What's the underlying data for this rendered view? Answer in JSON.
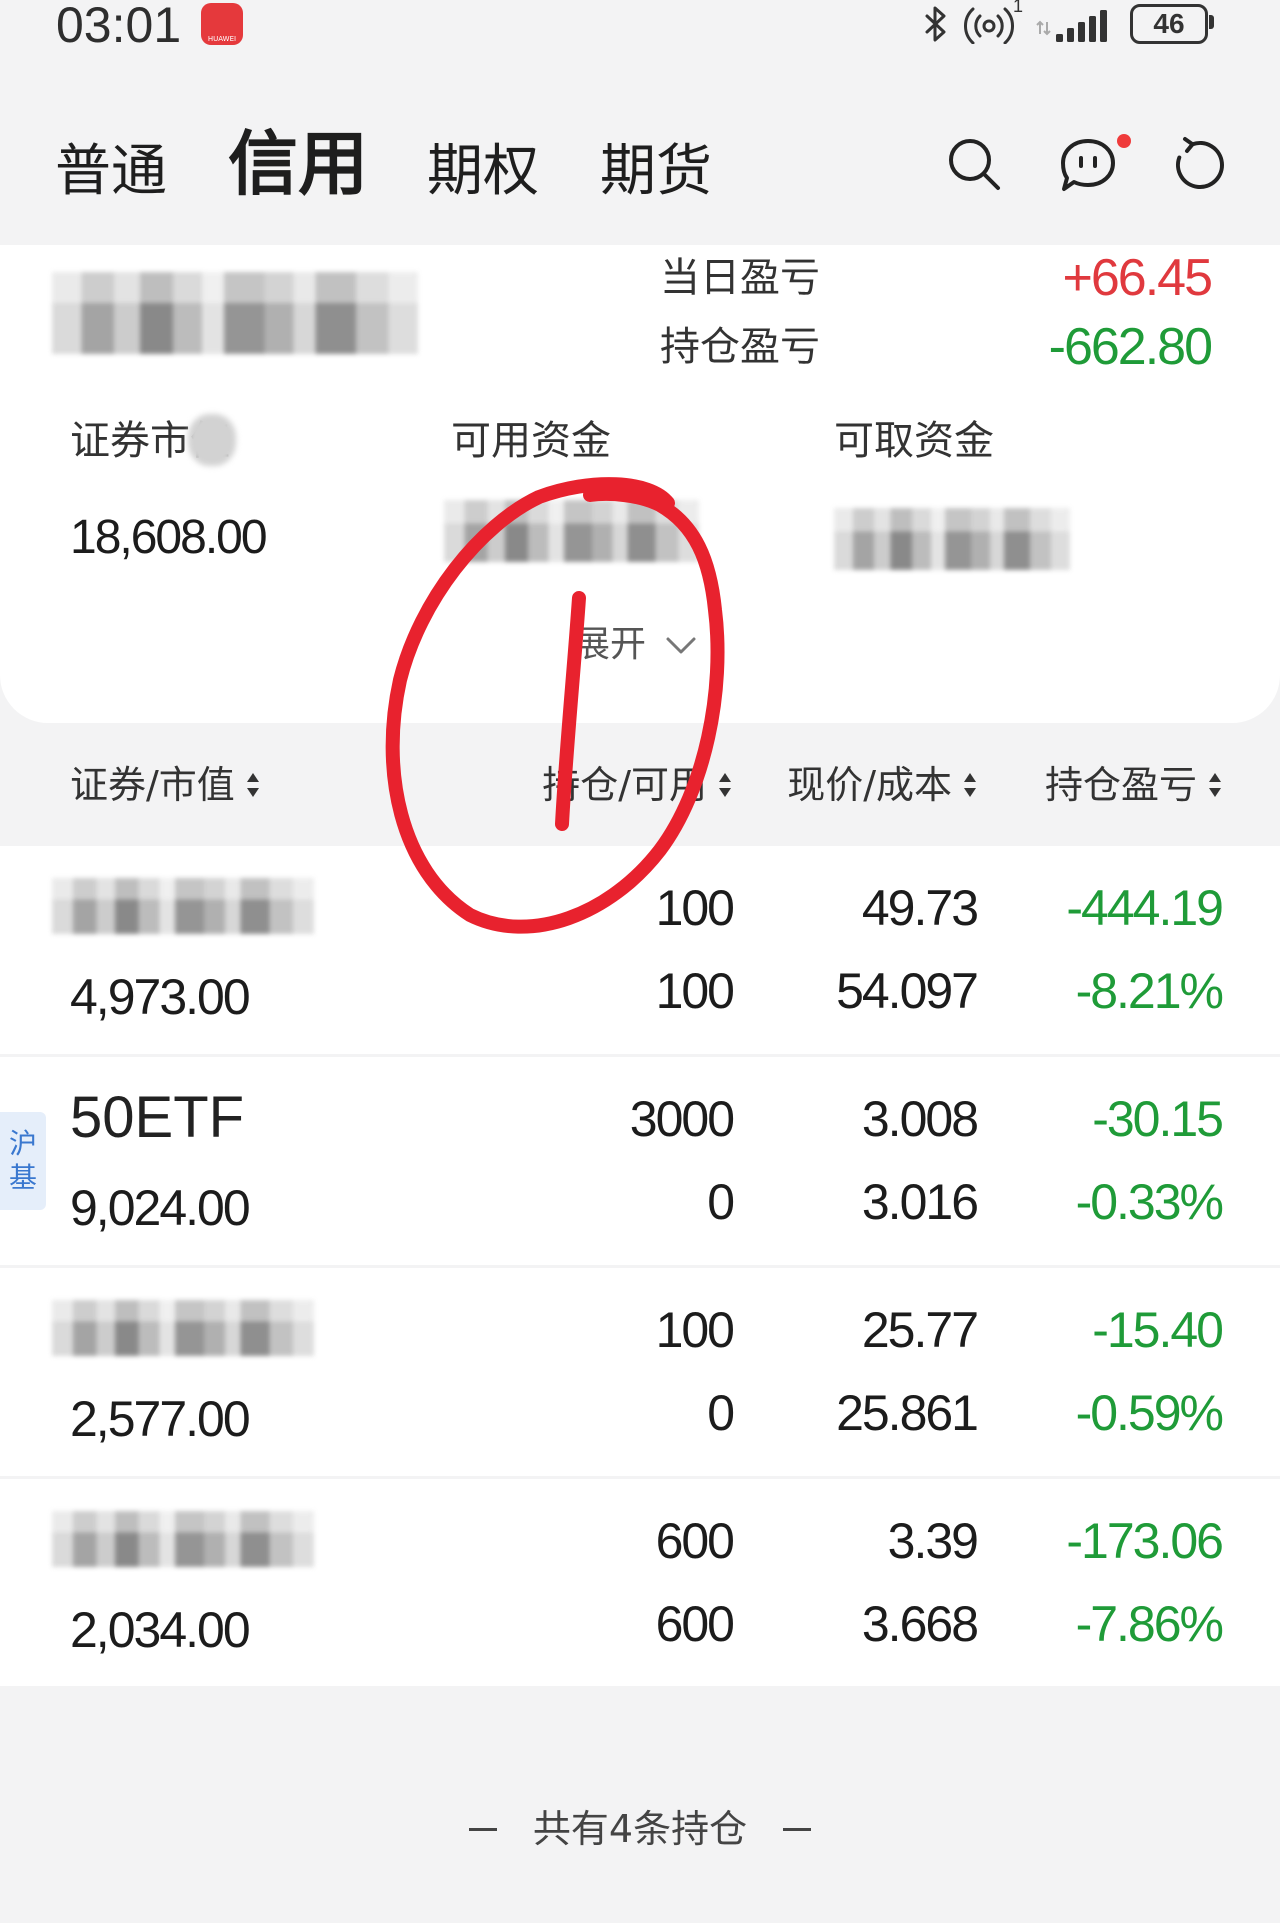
{
  "status_bar": {
    "time": "03:01",
    "app_icon_label": "HUAWEI",
    "hotspot_badge": "1",
    "battery_level": "46",
    "icons": [
      "huawei-app-icon",
      "bluetooth-icon",
      "hotspot-icon",
      "signal-icon",
      "battery-icon"
    ]
  },
  "tabs": [
    {
      "label": "普通",
      "active": false
    },
    {
      "label": "信用",
      "active": true
    },
    {
      "label": "期权",
      "active": false
    },
    {
      "label": "期货",
      "active": false
    }
  ],
  "toolbar": {
    "icons": [
      "search-icon",
      "chat-icon",
      "refresh-icon"
    ],
    "chat_has_unread": true
  },
  "summary": {
    "daily_pnl_label": "当日盈亏",
    "daily_pnl": "+66.45",
    "position_pnl_label": "持仓盈亏",
    "position_pnl": "-662.80",
    "market_value_label": "证券市值",
    "market_value": "18,608.00",
    "available_funds_label": "可用资金",
    "withdrawable_funds_label": "可取资金",
    "expand_label": "展开",
    "expand_icon": "chevron-down-icon"
  },
  "table": {
    "headers": [
      "证券/市值",
      "持仓/可用",
      "现价/成本",
      "持仓盈亏"
    ],
    "sort_icon": "sort-icon",
    "rows": [
      {
        "market_value": "4,973.00",
        "position": "100",
        "available": "100",
        "price": "49.73",
        "cost": "54.097",
        "pnl": "-444.19",
        "pnl_pct": "-8.21%"
      },
      {
        "name": "50ETF",
        "tag": "沪基",
        "market_value": "9,024.00",
        "position": "3000",
        "available": "0",
        "price": "3.008",
        "cost": "3.016",
        "pnl": "-30.15",
        "pnl_pct": "-0.33%"
      },
      {
        "market_value": "2,577.00",
        "position": "100",
        "available": "0",
        "price": "25.77",
        "cost": "25.861",
        "pnl": "-15.40",
        "pnl_pct": "-0.59%"
      },
      {
        "market_value": "2,034.00",
        "position": "600",
        "available": "600",
        "price": "3.39",
        "cost": "3.668",
        "pnl": "-173.06",
        "pnl_pct": "-7.86%"
      }
    ]
  },
  "footer": {
    "text": "共有4条持仓"
  },
  "colors": {
    "gain": "#e0393e",
    "loss": "#1f9b38",
    "tag_background": "#e5eefa",
    "tag_text": "#3a78cf",
    "annotation": "#e8222e",
    "notification_dot": "#ef3b3b"
  }
}
